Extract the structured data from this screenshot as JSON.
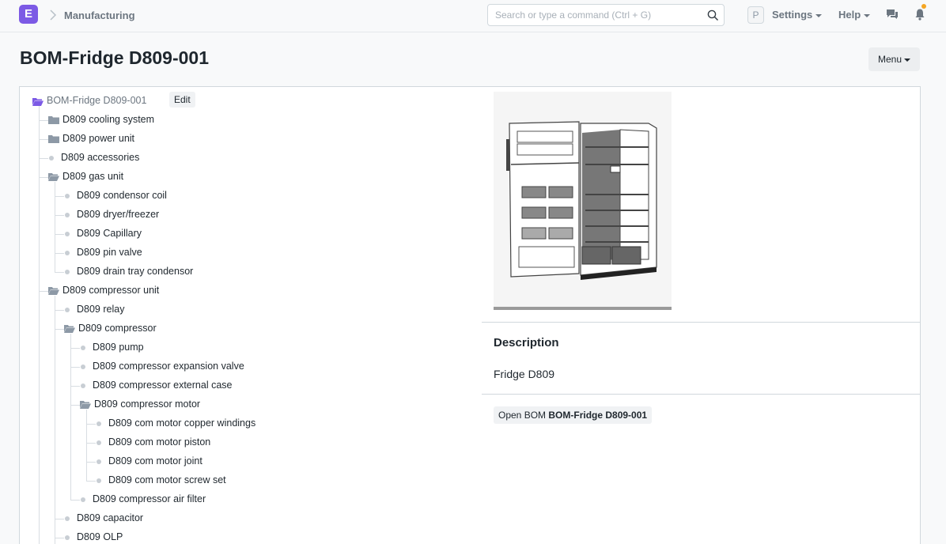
{
  "app": {
    "logo_letter": "E",
    "breadcrumb": "Manufacturing"
  },
  "search": {
    "placeholder": "Search or type a command (Ctrl + G)"
  },
  "navbar": {
    "avatar_letter": "P",
    "settings": "Settings",
    "help": "Help"
  },
  "page": {
    "title": "BOM-Fridge D809-001",
    "menu_label": "Menu"
  },
  "tree": {
    "root": "BOM-Fridge D809-001",
    "edit_label": "Edit",
    "nodes": [
      "D809 cooling system",
      "D809 power unit",
      "D809 accessories",
      "D809 gas unit",
      "D809 condensor coil",
      "D809 dryer/freezer",
      "D809 Capillary",
      "D809 pin valve",
      "D809 drain tray condensor",
      "D809 compressor unit",
      "D809 relay",
      "D809 compressor",
      "D809 pump",
      "D809 compressor expansion valve",
      "D809 compressor external case",
      "D809 compressor motor",
      "D809 com motor copper windings",
      "D809 com motor piston",
      "D809 com motor joint",
      "D809 com motor screw set",
      "D809 compressor air filter",
      "D809 capacitor",
      "D809 OLP"
    ]
  },
  "panel": {
    "description_heading": "Description",
    "description_value": "Fridge D809",
    "open_bom_prefix": "Open BOM",
    "open_bom_name": "BOM-Fridge D809-001"
  },
  "colors": {
    "brand": "#7c5ae5",
    "notification": "#f5a623",
    "folder": "#8d99a6",
    "root_folder": "#7c5ae5"
  }
}
